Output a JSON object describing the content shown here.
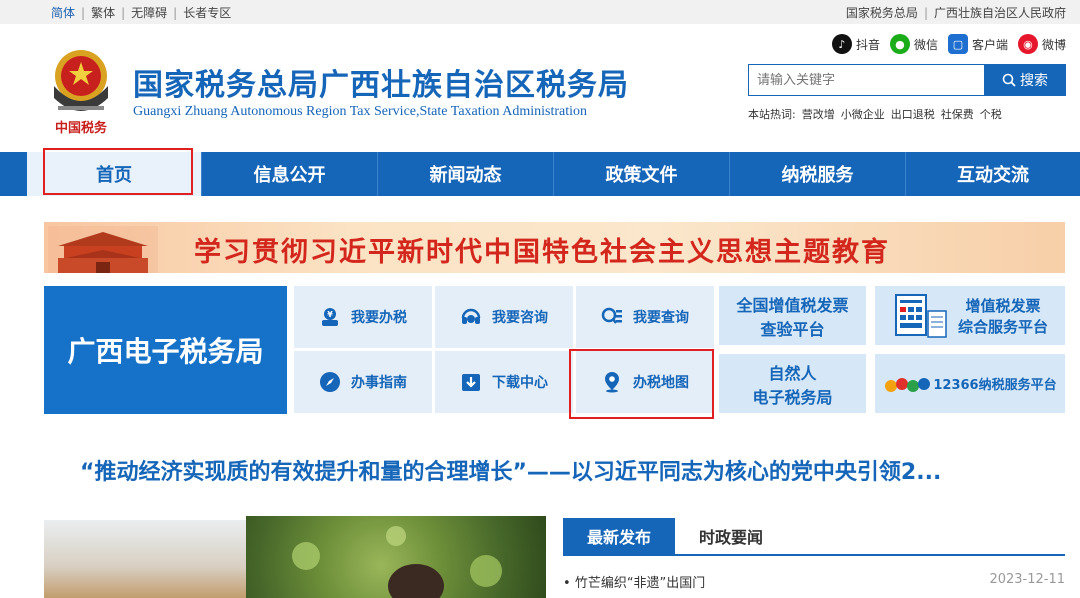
{
  "topbar": {
    "left": [
      "简体",
      "繁体",
      "无障碍",
      "长者专区"
    ],
    "right": [
      "国家税务总局",
      "广西壮族自治区人民政府"
    ]
  },
  "header": {
    "emblem_text": "中国税务",
    "title": "国家税务总局广西壮族自治区税务局",
    "subtitle": "Guangxi Zhuang Autonomous Region Tax Service,State Taxation Administration"
  },
  "socials": [
    {
      "label": "抖音",
      "icon": "douyin-icon",
      "color": "#111111"
    },
    {
      "label": "微信",
      "icon": "wechat-icon",
      "color": "#1aad19"
    },
    {
      "label": "客户端",
      "icon": "app-client-icon",
      "color": "#1e6fd0"
    },
    {
      "label": "微博",
      "icon": "weibo-icon",
      "color": "#e6162d"
    }
  ],
  "search": {
    "placeholder": "请输入关键字",
    "button": "搜索",
    "hot_label": "本站热词:",
    "hot_words": [
      "营改增",
      "小微企业",
      "出口退税",
      "社保费",
      "个税"
    ]
  },
  "nav": [
    "首页",
    "信息公开",
    "新闻动态",
    "政策文件",
    "纳税服务",
    "互动交流"
  ],
  "banner": {
    "text": "学习贯彻习近平新时代中国特色社会主义思想主题教育"
  },
  "etax": {
    "label": "广西电子税务局"
  },
  "services": [
    {
      "label": "我要办税",
      "icon": "tax-handling-icon"
    },
    {
      "label": "我要咨询",
      "icon": "consult-headset-icon"
    },
    {
      "label": "我要查询",
      "icon": "query-search-icon"
    },
    {
      "label": "办事指南",
      "icon": "compass-guide-icon"
    },
    {
      "label": "下载中心",
      "icon": "download-icon"
    },
    {
      "label": "办税地图",
      "icon": "map-pin-icon"
    }
  ],
  "right_tiles": {
    "invoice_check": [
      "全国增值税发票",
      "查验平台"
    ],
    "invoice_service": [
      "增值税发票",
      "综合服务平台"
    ],
    "natural_person": [
      "自然人",
      "电子税务局"
    ],
    "hotline": "12366纳税服务平台"
  },
  "headline": "“推动经济实现质的有效提升和量的合理增长”——以习近平同志为核心的党中央引领2...",
  "news": {
    "tabs": [
      "最新发布",
      "时政要闻"
    ],
    "items": [
      {
        "title": "竹芒编织“非遗”出国门",
        "date": "2023-12-11"
      }
    ]
  },
  "colors": {
    "brand": "#1565b8",
    "highlight": "#e02020",
    "banner_text": "#d3261c"
  }
}
